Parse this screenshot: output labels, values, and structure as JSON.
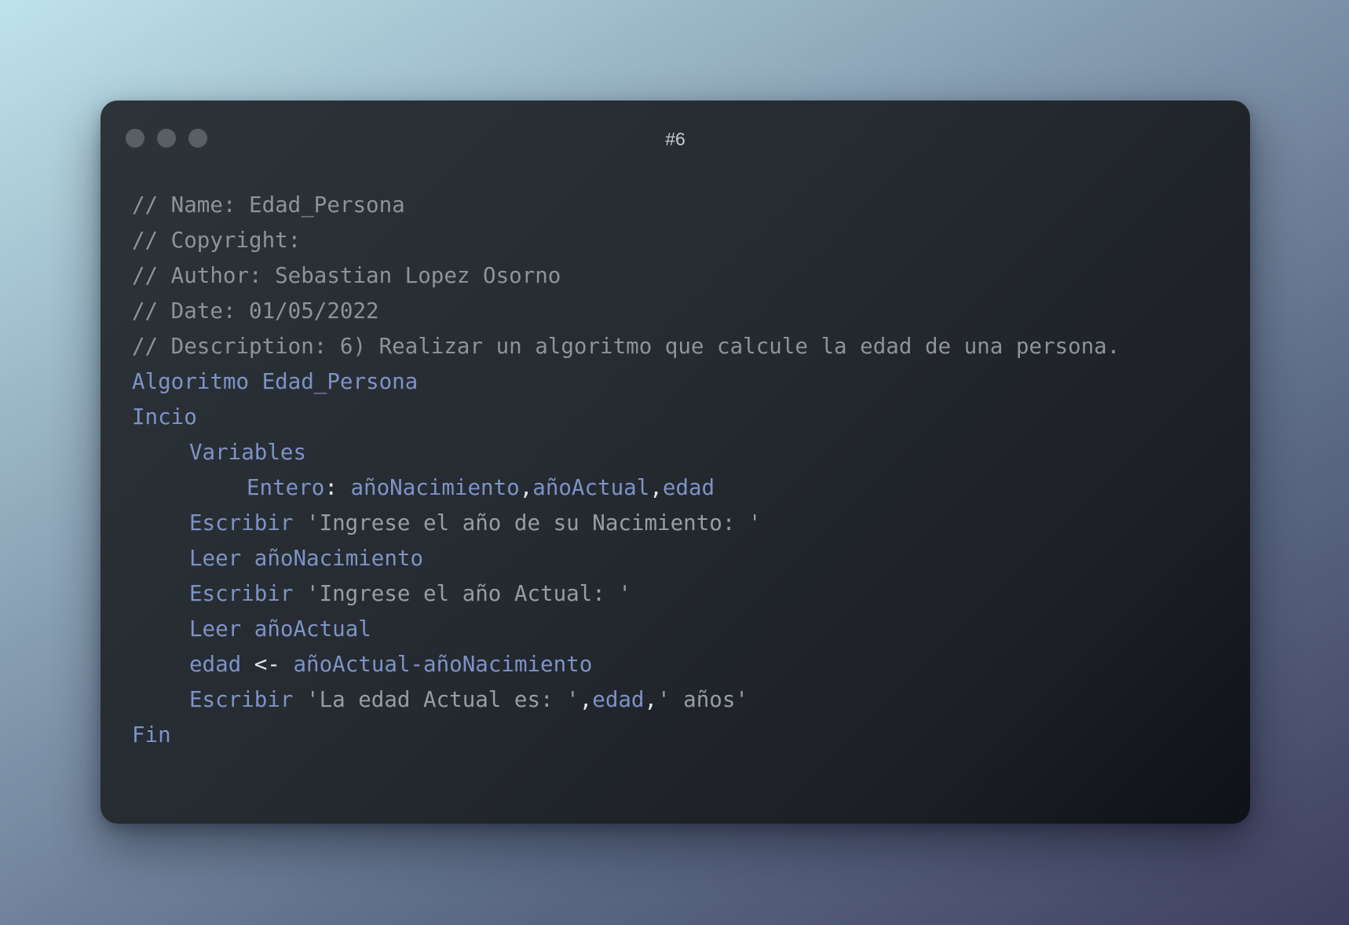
{
  "window": {
    "title": "#6"
  },
  "code": {
    "comments": [
      "// Name: Edad_Persona",
      "// Copyright:",
      "// Author: Sebastian Lopez Osorno",
      "// Date: 01/05/2022",
      "// Description: 6) Realizar un algoritmo que calcule la edad de una persona."
    ],
    "algoritmo_line": "Algoritmo Edad_Persona",
    "inicio": "Incio",
    "variables": "Variables",
    "decl_type": "Entero",
    "decl_colon": ":",
    "decl_var1": "añoNacimiento",
    "comma": ",",
    "decl_var2": "añoActual",
    "decl_var3": "edad",
    "escribir": "Escribir",
    "leer": "Leer",
    "str_nacimiento": "'Ingrese el año de su Nacimiento: '",
    "leer1_var": "añoNacimiento",
    "str_actual": "'Ingrese el año Actual: '",
    "leer2_var": "añoActual",
    "assign_target": "edad",
    "assign_op": "<-",
    "assign_expr": "añoActual-añoNacimiento",
    "str_edad": "'La edad Actual es: '",
    "out_var": "edad",
    "str_anos": "' años'",
    "fin": "Fin"
  },
  "colors": {
    "comment": "#8c939b",
    "keyword": "#7f92c7",
    "string": "#969da6",
    "punctuation": "#e4e7ea",
    "window_dots": "#5a5f63"
  }
}
